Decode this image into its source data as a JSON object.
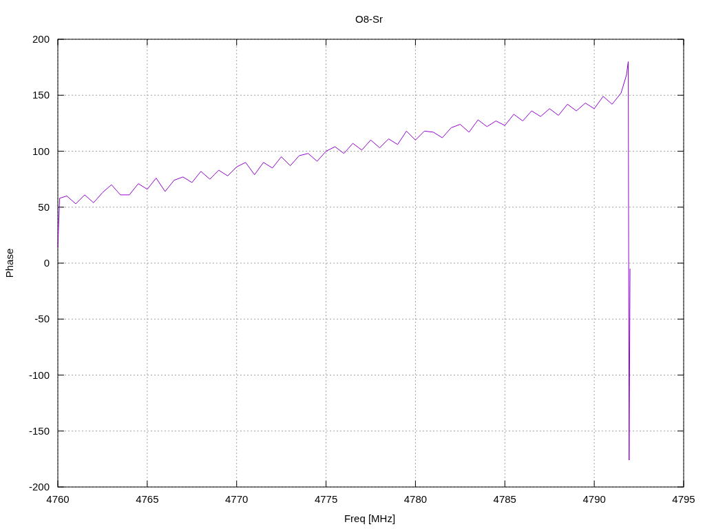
{
  "chart_data": {
    "type": "line",
    "grid": true,
    "title": "O8-Sr",
    "xlabel": "Freq [MHz]",
    "ylabel": "Phase",
    "xlim": [
      4760,
      4795
    ],
    "ylim": [
      -200,
      200
    ],
    "xticks": [
      4760,
      4765,
      4770,
      4775,
      4780,
      4785,
      4790,
      4795
    ],
    "yticks": [
      -200,
      -150,
      -100,
      -50,
      0,
      50,
      100,
      150,
      200
    ],
    "x": [
      4760,
      4760.1,
      4760.5,
      4761,
      4761.5,
      4762,
      4762.5,
      4763,
      4763.5,
      4764,
      4764.5,
      4765,
      4765.5,
      4766,
      4766.5,
      4767,
      4767.5,
      4768,
      4768.5,
      4769,
      4769.5,
      4770,
      4770.5,
      4771,
      4771.5,
      4772,
      4772.5,
      4773,
      4773.5,
      4774,
      4774.5,
      4775,
      4775.5,
      4776,
      4776.5,
      4777,
      4777.5,
      4778,
      4778.5,
      4779,
      4779.5,
      4780,
      4780.5,
      4781,
      4781.5,
      4782,
      4782.5,
      4783,
      4783.5,
      4784,
      4784.5,
      4785,
      4785.5,
      4786,
      4786.5,
      4787,
      4787.5,
      4788,
      4788.5,
      4789,
      4789.5,
      4790,
      4790.5,
      4791,
      4791.5,
      4791.8,
      4791.9,
      4791.95,
      4792
    ],
    "series": [
      {
        "color": "#9400d3",
        "values": [
          14,
          58,
          60,
          53,
          61,
          54,
          63,
          70,
          61,
          61,
          71,
          66,
          76,
          64,
          74,
          77,
          72,
          82,
          75,
          83,
          78,
          86,
          90,
          79,
          90,
          85,
          95,
          87,
          96,
          98,
          91,
          100,
          104,
          98,
          107,
          101,
          110,
          103,
          111,
          106,
          118,
          110,
          118,
          117,
          112,
          121,
          124,
          117,
          128,
          122,
          127,
          123,
          133,
          127,
          136,
          131,
          138,
          132,
          142,
          136,
          143,
          138,
          149,
          142,
          152,
          168,
          180,
          -176,
          -5
        ]
      }
    ]
  }
}
